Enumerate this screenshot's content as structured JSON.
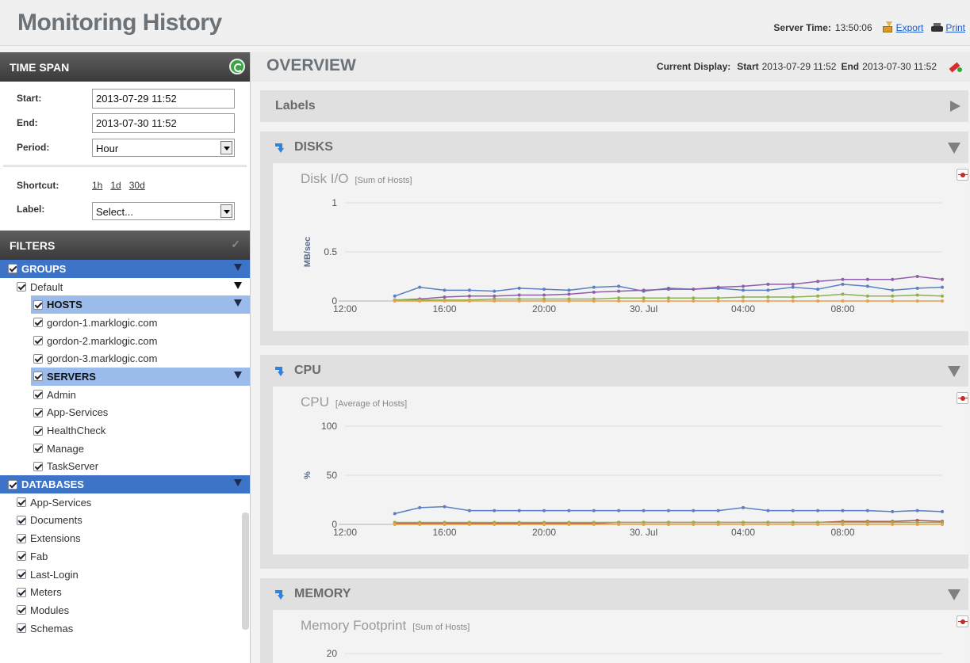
{
  "header": {
    "title": "Monitoring History",
    "server_time_label": "Server Time:",
    "server_time": "13:50:06",
    "export_label": "Export",
    "print_label": "Print"
  },
  "time_span": {
    "title": "TIME SPAN",
    "start_label": "Start:",
    "start_value": "2013-07-29 11:52",
    "end_label": "End:",
    "end_value": "2013-07-30 11:52",
    "period_label": "Period:",
    "period_value": "Hour",
    "shortcut_label": "Shortcut:",
    "shortcuts": [
      "1h",
      "1d",
      "30d"
    ],
    "label_label": "Label:",
    "label_value": "Select..."
  },
  "filters": {
    "title": "FILTERS",
    "groups_label": "GROUPS",
    "default_label": "Default",
    "hosts_label": "HOSTS",
    "hosts": [
      "gordon-1.marklogic.com",
      "gordon-2.marklogic.com",
      "gordon-3.marklogic.com"
    ],
    "servers_label": "SERVERS",
    "servers": [
      "Admin",
      "App-Services",
      "HealthCheck",
      "Manage",
      "TaskServer"
    ],
    "databases_label": "DATABASES",
    "databases": [
      "App-Services",
      "Documents",
      "Extensions",
      "Fab",
      "Last-Login",
      "Meters",
      "Modules",
      "Schemas"
    ]
  },
  "overview": {
    "title": "OVERVIEW",
    "current_display_label": "Current Display:",
    "start_label": "Start",
    "start_value": "2013-07-29 11:52",
    "end_label": "End",
    "end_value": "2013-07-30 11:52"
  },
  "sections": {
    "labels": "Labels",
    "disks": "DISKS",
    "cpu": "CPU",
    "memory": "MEMORY"
  },
  "colors": {
    "blue": "#5a7fc2",
    "purple": "#8e5fa8",
    "green": "#8fb04a",
    "orange": "#e8a04a",
    "red": "#c0504d",
    "header_dark": "#3d74c7",
    "header_light": "#9bbbea"
  },
  "chart_data": [
    {
      "type": "line",
      "title": "Disk I/O",
      "subtitle": "[Sum of Hosts]",
      "ylabel": "MB/sec",
      "ylim": [
        0,
        1
      ],
      "y_ticks": [
        "0",
        "0.5",
        "1"
      ],
      "x_ticks": [
        "12:00",
        "16:00",
        "20:00",
        "30. Jul",
        "04:00",
        "08:00"
      ],
      "x_hours": [
        0,
        4,
        8,
        12,
        16,
        20
      ],
      "x_range": [
        0,
        24
      ],
      "series": [
        {
          "color": "#5a7fc2",
          "x": [
            2,
            3,
            4,
            5,
            6,
            7,
            8,
            9,
            10,
            11,
            12,
            13,
            14,
            15,
            16,
            17,
            18,
            19,
            20,
            21,
            22,
            23,
            24
          ],
          "values": [
            0.05,
            0.14,
            0.11,
            0.11,
            0.1,
            0.13,
            0.12,
            0.11,
            0.14,
            0.15,
            0.1,
            0.13,
            0.12,
            0.13,
            0.11,
            0.11,
            0.14,
            0.12,
            0.17,
            0.15,
            0.11,
            0.13,
            0.14
          ]
        },
        {
          "color": "#8e5fa8",
          "x": [
            2,
            3,
            4,
            5,
            6,
            7,
            8,
            9,
            10,
            11,
            12,
            13,
            14,
            15,
            16,
            17,
            18,
            19,
            20,
            21,
            22,
            23,
            24
          ],
          "values": [
            0.01,
            0.02,
            0.04,
            0.05,
            0.05,
            0.06,
            0.06,
            0.07,
            0.09,
            0.1,
            0.11,
            0.12,
            0.12,
            0.14,
            0.15,
            0.17,
            0.17,
            0.2,
            0.22,
            0.22,
            0.22,
            0.25,
            0.22
          ]
        },
        {
          "color": "#8fb04a",
          "x": [
            2,
            3,
            4,
            5,
            6,
            7,
            8,
            9,
            10,
            11,
            12,
            13,
            14,
            15,
            16,
            17,
            18,
            19,
            20,
            21,
            22,
            23,
            24
          ],
          "values": [
            0.01,
            0.01,
            0.01,
            0.01,
            0.02,
            0.02,
            0.02,
            0.02,
            0.02,
            0.03,
            0.03,
            0.03,
            0.03,
            0.03,
            0.04,
            0.04,
            0.04,
            0.05,
            0.07,
            0.05,
            0.05,
            0.06,
            0.05
          ]
        },
        {
          "color": "#e8a04a",
          "x": [
            2,
            3,
            4,
            5,
            6,
            7,
            8,
            9,
            10,
            11,
            12,
            13,
            14,
            15,
            16,
            17,
            18,
            19,
            20,
            21,
            22,
            23,
            24
          ],
          "values": [
            0,
            0,
            0,
            0,
            0,
            0,
            0,
            0,
            0,
            0,
            0,
            0,
            0,
            0,
            0,
            0,
            0,
            0,
            0,
            0,
            0,
            0,
            0
          ]
        }
      ]
    },
    {
      "type": "line",
      "title": "CPU",
      "subtitle": "[Average of Hosts]",
      "ylabel": "%",
      "ylim": [
        0,
        100
      ],
      "y_ticks": [
        "0",
        "50",
        "100"
      ],
      "x_ticks": [
        "12:00",
        "16:00",
        "20:00",
        "30. Jul",
        "04:00",
        "08:00"
      ],
      "x_hours": [
        0,
        4,
        8,
        12,
        16,
        20
      ],
      "x_range": [
        0,
        24
      ],
      "series": [
        {
          "color": "#5a7fc2",
          "x": [
            2,
            3,
            4,
            5,
            6,
            7,
            8,
            9,
            10,
            11,
            12,
            13,
            14,
            15,
            16,
            17,
            18,
            19,
            20,
            21,
            22,
            23,
            24
          ],
          "values": [
            11,
            17,
            18,
            14,
            14,
            14,
            14,
            14,
            14,
            14,
            14,
            14,
            14,
            14,
            17,
            14,
            14,
            14,
            14,
            14,
            13,
            14,
            13
          ]
        },
        {
          "color": "#c0504d",
          "x": [
            2,
            3,
            4,
            5,
            6,
            7,
            8,
            9,
            10,
            11,
            12,
            13,
            14,
            15,
            16,
            17,
            18,
            19,
            20,
            21,
            22,
            23,
            24
          ],
          "values": [
            1,
            1,
            1,
            1,
            1,
            1,
            1,
            1,
            1,
            2,
            2,
            2,
            2,
            2,
            2,
            2,
            2,
            2,
            3,
            3,
            3,
            4,
            3
          ]
        },
        {
          "color": "#8fb04a",
          "x": [
            2,
            3,
            4,
            5,
            6,
            7,
            8,
            9,
            10,
            11,
            12,
            13,
            14,
            15,
            16,
            17,
            18,
            19,
            20,
            21,
            22,
            23,
            24
          ],
          "values": [
            2,
            2,
            2,
            2,
            2,
            2,
            2,
            2,
            2,
            2,
            2,
            2,
            2,
            2,
            2,
            2,
            2,
            2,
            2,
            2,
            2,
            2,
            2
          ]
        },
        {
          "color": "#e8a04a",
          "x": [
            2,
            3,
            4,
            5,
            6,
            7,
            8,
            9,
            10,
            11,
            12,
            13,
            14,
            15,
            16,
            17,
            18,
            19,
            20,
            21,
            22,
            23,
            24
          ],
          "values": [
            0,
            0,
            0,
            0,
            0,
            0,
            0,
            0,
            0,
            0,
            0,
            0,
            0,
            0,
            0,
            0,
            0,
            0,
            0,
            0,
            0,
            0,
            0
          ]
        }
      ]
    },
    {
      "type": "line",
      "title": "Memory Footprint",
      "subtitle": "[Sum of Hosts]",
      "y_ticks": [
        "20"
      ]
    }
  ]
}
